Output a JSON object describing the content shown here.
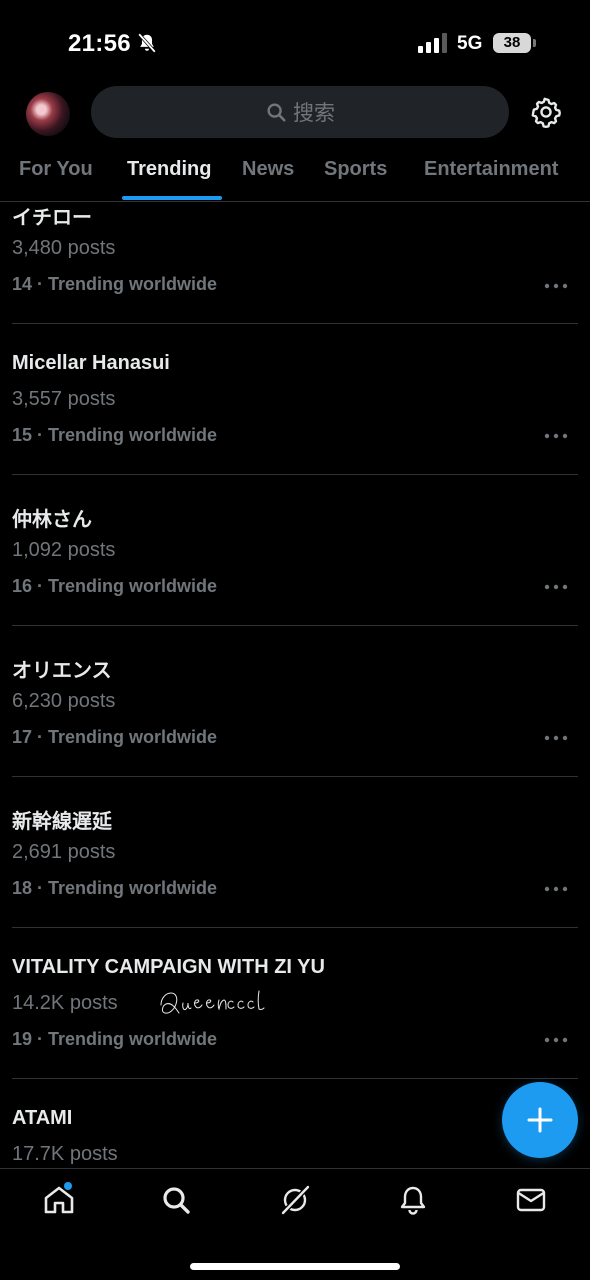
{
  "status_bar": {
    "time": "21:56",
    "network": "5G",
    "battery": "38"
  },
  "header": {
    "search_placeholder": "搜索"
  },
  "tabs": [
    {
      "label": "For You",
      "active": false
    },
    {
      "label": "Trending",
      "active": true
    },
    {
      "label": "News",
      "active": false
    },
    {
      "label": "Sports",
      "active": false
    },
    {
      "label": "Entertainment",
      "active": false
    }
  ],
  "trends": [
    {
      "name": "イチロー",
      "posts": "3,480 posts",
      "meta": "14 · Trending worldwide"
    },
    {
      "name": "Micellar Hanasui",
      "posts": "3,557 posts",
      "meta": "15 · Trending worldwide"
    },
    {
      "name": "仲林さん",
      "posts": "1,092 posts",
      "meta": "16 · Trending worldwide"
    },
    {
      "name": "オリエンス",
      "posts": "6,230 posts",
      "meta": "17 · Trending worldwide"
    },
    {
      "name": "新幹線遅延",
      "posts": "2,691 posts",
      "meta": "18 · Trending worldwide"
    },
    {
      "name": "VITALITY CAMPAIGN WITH ZI YU",
      "posts": "14.2K posts",
      "meta": "19 · Trending worldwide"
    },
    {
      "name": "ATAMI",
      "posts": "17.7K posts",
      "meta": ""
    }
  ],
  "signature_text": "Queencccl",
  "colors": {
    "accent": "#1d9bf0",
    "background": "#000000",
    "muted": "#71767b",
    "text": "#e7e9ea",
    "divider": "#2f3336"
  },
  "icons": [
    "bell-off-icon",
    "signal-icon",
    "search-icon",
    "gear-icon",
    "more-icon",
    "plus-icon",
    "home-icon",
    "explore-icon",
    "grok-icon",
    "notifications-icon",
    "messages-icon"
  ]
}
